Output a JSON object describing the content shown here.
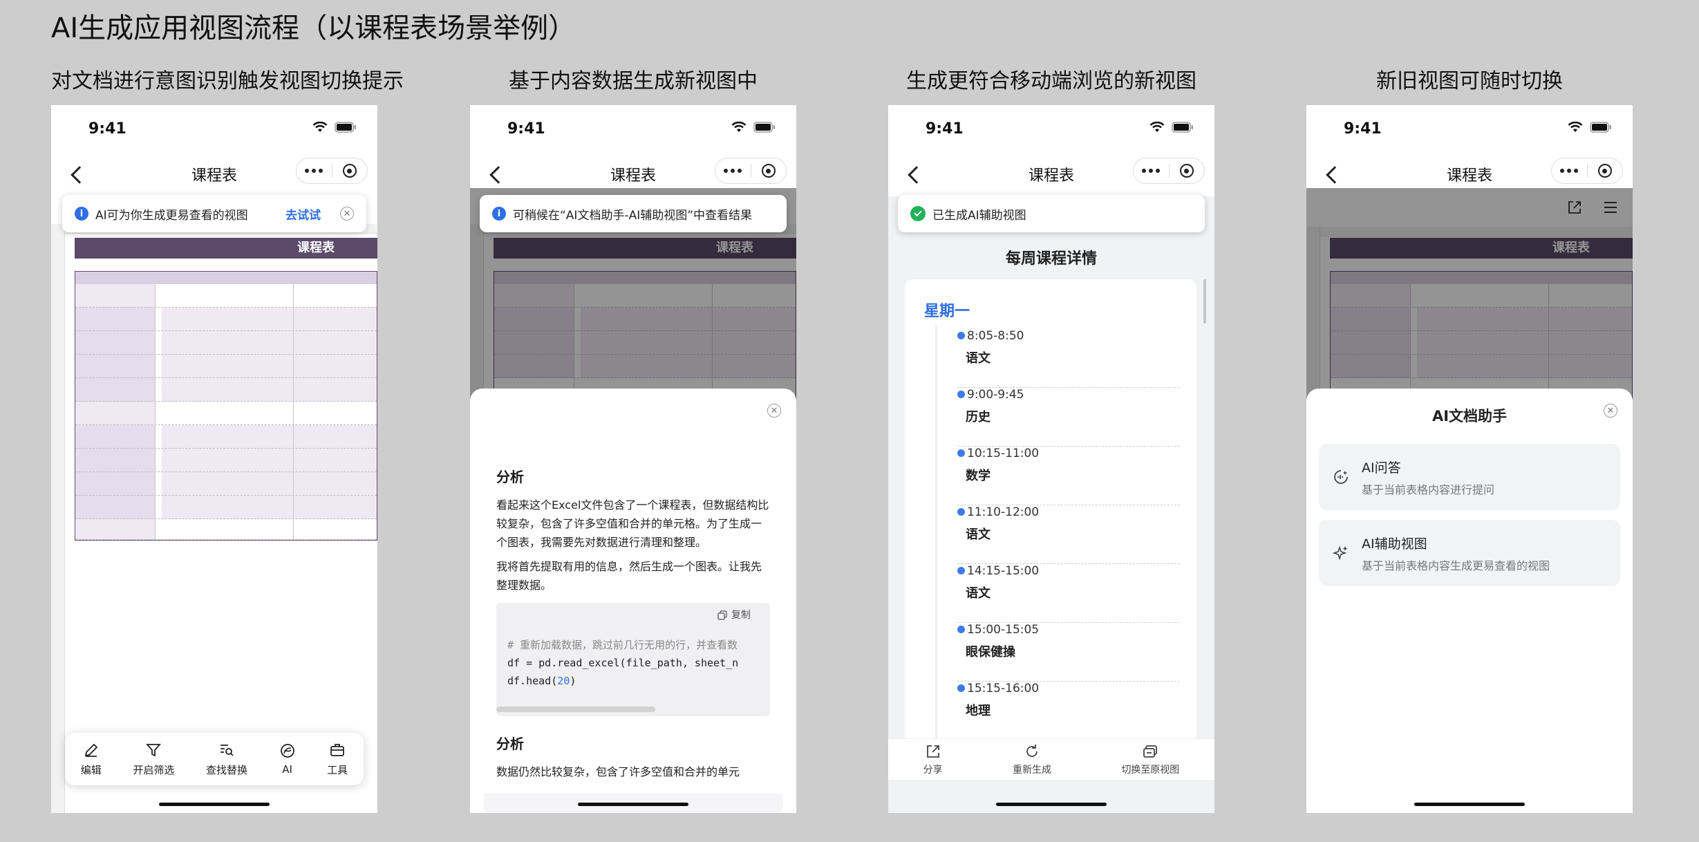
{
  "page": {
    "title": "AI生成应用视图流程（以课程表场景举例）"
  },
  "columns": [
    {
      "title": "对文档进行意图识别触发视图切换提示"
    },
    {
      "title": "基于内容数据生成新视图中"
    },
    {
      "title": "生成更符合移动端浏览的新视图"
    },
    {
      "title": "新旧视图可随时切换"
    }
  ],
  "status_time": "9:41",
  "nav_title": "课程表",
  "sheet": {
    "title": "课程表"
  },
  "phone1": {
    "toast_text": "AI可为你生成更易查看的视图",
    "toast_link": "去试试",
    "toolbar": [
      {
        "label": "编辑",
        "icon": "edit-icon"
      },
      {
        "label": "开启筛选",
        "icon": "filter-icon"
      },
      {
        "label": "查找替换",
        "icon": "find-replace-icon"
      },
      {
        "label": "AI",
        "icon": "ai-icon"
      },
      {
        "label": "工具",
        "icon": "toolbox-icon"
      }
    ]
  },
  "phone2": {
    "toast_text": "可稍候在“AI文档助手-AI辅助视图”中查看结果",
    "analysis_heading": "分析",
    "para1": "看起来这个Excel文件包含了一个课程表，但数据结构比较复杂，包含了许多空值和合并的单元格。为了生成一个图表，我需要先对数据进行清理和整理。",
    "para2": "我将首先提取有用的信息，然后生成一个图表。让我先整理数据。",
    "copy_label": "复制",
    "code_line1": "# 重新加载数据，跳过前几行无用的行，并查看数",
    "code_line2": "df = pd.read_excel(file_path, sheet_n",
    "code_line3_a": "df.head(",
    "code_line3_num": "20",
    "code_line3_b": ")",
    "analysis_heading2": "分析",
    "para3": "数据仍然比较复杂，包含了许多空值和合并的单元"
  },
  "phone3": {
    "toast_text": "已生成AI辅助视图",
    "view_title": "每周课程详情",
    "day": "星期一",
    "slots": [
      {
        "time": "8:05-8:50",
        "subject": "语文"
      },
      {
        "time": "9:00-9:45",
        "subject": "历史"
      },
      {
        "time": "10:15-11:00",
        "subject": "数学"
      },
      {
        "time": "11:10-12:00",
        "subject": "语文"
      },
      {
        "time": "14:15-15:00",
        "subject": "语文"
      },
      {
        "time": "15:00-15:05",
        "subject": "眼保健操"
      },
      {
        "time": "15:15-16:00",
        "subject": "地理"
      }
    ],
    "actions": [
      {
        "label": "分享",
        "icon": "share-icon"
      },
      {
        "label": "重新生成",
        "icon": "regenerate-icon"
      },
      {
        "label": "切换至原视图",
        "icon": "switch-view-icon"
      }
    ]
  },
  "phone4": {
    "panel_title": "AI文档助手",
    "items": [
      {
        "title": "AI问答",
        "subtitle": "基于当前表格内容进行提问",
        "icon": "ai-chat-icon"
      },
      {
        "title": "AI辅助视图",
        "subtitle": "基于当前表格内容生成更易查看的视图",
        "icon": "sparkle-icon"
      }
    ]
  },
  "colors": {
    "accent": "#2e6fe3",
    "sheet_header": "#5c4a6b",
    "sheet_lavender": "#e5dcec",
    "background": "#cdcdcd"
  }
}
